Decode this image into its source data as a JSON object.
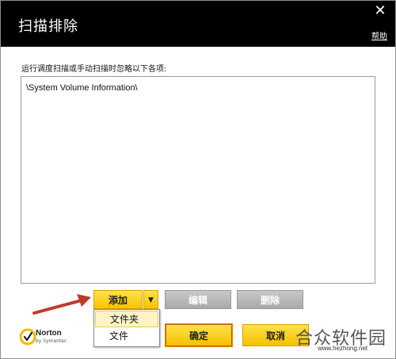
{
  "dialog": {
    "title": "扫描排除",
    "close_icon": "close-icon",
    "help_link": "帮助",
    "description": "运行调度扫描或手动扫描时忽略以下各项:",
    "exclusions": [
      "\\System Volume Information\\"
    ]
  },
  "buttons": {
    "add": "添加",
    "add_dropdown_icon": "triangle-down-icon",
    "edit": "编辑",
    "delete": "删除",
    "ok": "确定",
    "cancel": "取消"
  },
  "add_menu": {
    "items": [
      "文件夹",
      "文件"
    ],
    "highlighted_index": 0
  },
  "branding": {
    "logo_name": "Norton",
    "logo_sub": "by Symantec"
  },
  "watermark": {
    "text": "合众软件园",
    "url": "www.hezhong.net"
  },
  "colors": {
    "titlebar_bg": "#000000",
    "accent_yellow": "#f8c400",
    "disabled_gray": "#b3b3b3",
    "arrow_red": "#c0392b"
  }
}
